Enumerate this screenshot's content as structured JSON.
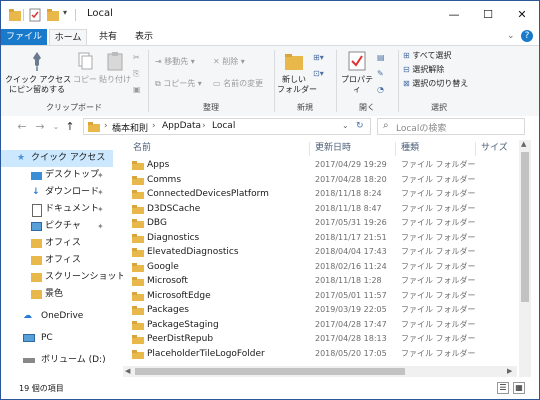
{
  "titlebar": {
    "title": "Local",
    "minimize_glyph": "—",
    "maximize_glyph": "☐",
    "close_glyph": "✕"
  },
  "tabs": {
    "file": "ファイル",
    "home": "ホーム",
    "share": "共有",
    "view": "表示"
  },
  "ribbon": {
    "clipboard": {
      "pin_quick": "クイック アクセス\nにピン留めする",
      "copy": "コピー",
      "paste": "貼り付け",
      "label": "クリップボード"
    },
    "organize": {
      "move_to": "移動先",
      "delete": "削除",
      "copy_to": "コピー先",
      "rename": "名前の変更",
      "label": "整理"
    },
    "new": {
      "new_folder": "新しい\nフォルダー",
      "label": "新規"
    },
    "open": {
      "properties": "プロパティ",
      "label": "開く"
    },
    "select": {
      "select_all": "すべて選択",
      "select_none": "選択解除",
      "invert": "選択の切り替え",
      "label": "選択"
    }
  },
  "address": {
    "crumbs": [
      "橋本和則",
      "AppData",
      "Local"
    ],
    "search_placeholder": "Localの検索"
  },
  "navpane": {
    "items": [
      {
        "label": "クイック アクセス",
        "icon": "star-icon",
        "pinned": false
      },
      {
        "label": "デスクトップ",
        "icon": "desktop-icon",
        "pinned": true
      },
      {
        "label": "ダウンロード",
        "icon": "download-icon",
        "pinned": true
      },
      {
        "label": "ドキュメント",
        "icon": "document-icon",
        "pinned": true
      },
      {
        "label": "ピクチャ",
        "icon": "picture-icon",
        "pinned": true
      },
      {
        "label": "オフィス",
        "icon": "folder-icon",
        "pinned": false
      },
      {
        "label": "オフィス",
        "icon": "folder-icon",
        "pinned": false
      },
      {
        "label": "スクリーンショット",
        "icon": "folder-icon",
        "pinned": false
      },
      {
        "label": "景色",
        "icon": "folder-icon",
        "pinned": false
      },
      {
        "label": "OneDrive",
        "icon": "cloud-icon",
        "pinned": false
      },
      {
        "label": "PC",
        "icon": "pc-icon",
        "pinned": false
      },
      {
        "label": "ボリューム (D:)",
        "icon": "drive-icon",
        "pinned": false
      }
    ]
  },
  "columns": {
    "name": "名前",
    "date": "更新日時",
    "type": "種類",
    "size": "サイズ"
  },
  "files": [
    {
      "name": "Apps",
      "date": "2017/04/29 19:29",
      "type": "ファイル フォルダー"
    },
    {
      "name": "Comms",
      "date": "2017/04/28 18:20",
      "type": "ファイル フォルダー"
    },
    {
      "name": "ConnectedDevicesPlatform",
      "date": "2018/11/18 8:24",
      "type": "ファイル フォルダー"
    },
    {
      "name": "D3DSCache",
      "date": "2018/11/18 8:47",
      "type": "ファイル フォルダー"
    },
    {
      "name": "DBG",
      "date": "2017/05/31 19:26",
      "type": "ファイル フォルダー"
    },
    {
      "name": "Diagnostics",
      "date": "2018/11/17 21:51",
      "type": "ファイル フォルダー"
    },
    {
      "name": "ElevatedDiagnostics",
      "date": "2018/04/04 17:43",
      "type": "ファイル フォルダー"
    },
    {
      "name": "Google",
      "date": "2018/02/16 11:24",
      "type": "ファイル フォルダー"
    },
    {
      "name": "Microsoft",
      "date": "2018/11/18 1:28",
      "type": "ファイル フォルダー"
    },
    {
      "name": "MicrosoftEdge",
      "date": "2017/05/01 11:57",
      "type": "ファイル フォルダー"
    },
    {
      "name": "Packages",
      "date": "2019/03/19 22:05",
      "type": "ファイル フォルダー"
    },
    {
      "name": "PackageStaging",
      "date": "2017/04/28 17:47",
      "type": "ファイル フォルダー"
    },
    {
      "name": "PeerDistRepub",
      "date": "2017/04/28 18:13",
      "type": "ファイル フォルダー"
    },
    {
      "name": "PlaceholderTileLogoFolder",
      "date": "2018/05/20 17:05",
      "type": "ファイル フォルダー"
    }
  ],
  "status": {
    "item_count": "19 個の項目"
  },
  "colors": {
    "accent": "#1979ca",
    "folder": "#e8b84a",
    "selection": "#cce8ff"
  }
}
